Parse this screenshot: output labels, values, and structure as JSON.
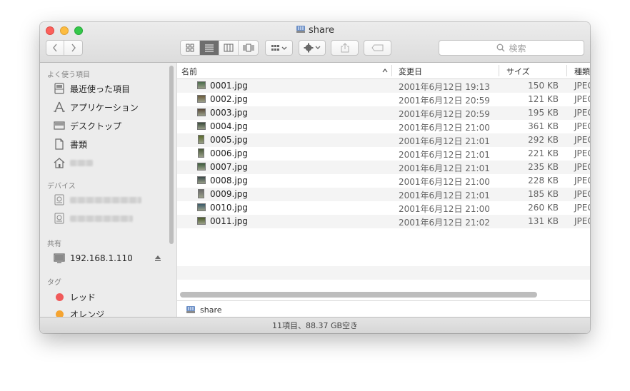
{
  "window": {
    "title": "share"
  },
  "toolbar": {
    "search_placeholder": "検索"
  },
  "sidebar": {
    "favorites_header": "よく使う項目",
    "favorites": [
      {
        "label": "最近使った項目",
        "icon": "recents-icon"
      },
      {
        "label": "アプリケーション",
        "icon": "applications-icon"
      },
      {
        "label": "デスクトップ",
        "icon": "desktop-icon"
      },
      {
        "label": "書類",
        "icon": "documents-icon"
      }
    ],
    "devices_header": "デバイス",
    "shared_header": "共有",
    "shared_item": "192.168.1.110",
    "tags_header": "タグ",
    "tags": [
      {
        "label": "レッド",
        "color": "#f05a5a"
      },
      {
        "label": "オレンジ",
        "color": "#f5a431"
      }
    ]
  },
  "columns": {
    "name": "名前",
    "date": "変更日",
    "size": "サイズ",
    "kind": "種類"
  },
  "files": [
    {
      "name": "0001.jpg",
      "date": "2001年6月12日 19:13",
      "size": "150 KB",
      "kind": "JPEG"
    },
    {
      "name": "0002.jpg",
      "date": "2001年6月12日 20:59",
      "size": "121 KB",
      "kind": "JPEG"
    },
    {
      "name": "0003.jpg",
      "date": "2001年6月12日 20:59",
      "size": "195 KB",
      "kind": "JPEG"
    },
    {
      "name": "0004.jpg",
      "date": "2001年6月12日 21:00",
      "size": "361 KB",
      "kind": "JPEG"
    },
    {
      "name": "0005.jpg",
      "date": "2001年6月12日 21:01",
      "size": "292 KB",
      "kind": "JPEG"
    },
    {
      "name": "0006.jpg",
      "date": "2001年6月12日 21:01",
      "size": "221 KB",
      "kind": "JPEG"
    },
    {
      "name": "0007.jpg",
      "date": "2001年6月12日 21:01",
      "size": "235 KB",
      "kind": "JPEG"
    },
    {
      "name": "0008.jpg",
      "date": "2001年6月12日 21:00",
      "size": "228 KB",
      "kind": "JPEG"
    },
    {
      "name": "0009.jpg",
      "date": "2001年6月12日 21:01",
      "size": "185 KB",
      "kind": "JPEG"
    },
    {
      "name": "0010.jpg",
      "date": "2001年6月12日 21:00",
      "size": "260 KB",
      "kind": "JPEG"
    },
    {
      "name": "0011.jpg",
      "date": "2001年6月12日 21:02",
      "size": "131 KB",
      "kind": "JPEG"
    }
  ],
  "pathbar": {
    "label": "share"
  },
  "status": {
    "text": "11項目、88.37 GB空き"
  }
}
